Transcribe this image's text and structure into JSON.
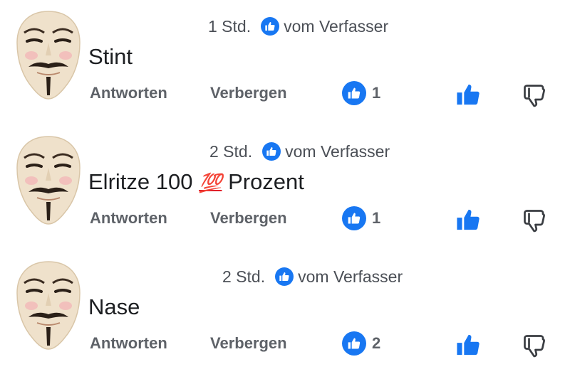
{
  "comments": [
    {
      "time": "1 Std.",
      "author_like": "vom Verfasser",
      "text": "Stint",
      "reply": "Antworten",
      "hide": "Verbergen",
      "likes": "1"
    },
    {
      "time": "2 Std.",
      "author_like": "vom Verfasser",
      "text_before": "Elritze 100 ",
      "emoji": "💯",
      "text_after": " Prozent",
      "reply": "Antworten",
      "hide": "Verbergen",
      "likes": "1"
    },
    {
      "time": "2 Std.",
      "author_like": "vom Verfasser",
      "text": "Nase",
      "reply": "Antworten",
      "hide": "Verbergen",
      "likes": "2"
    }
  ],
  "colors": {
    "accent": "#1877f2",
    "action_text": "#5e6268"
  },
  "icons": [
    "mask-avatar",
    "like-badge-icon",
    "thumbs-up-icon",
    "thumbs-down-icon"
  ]
}
